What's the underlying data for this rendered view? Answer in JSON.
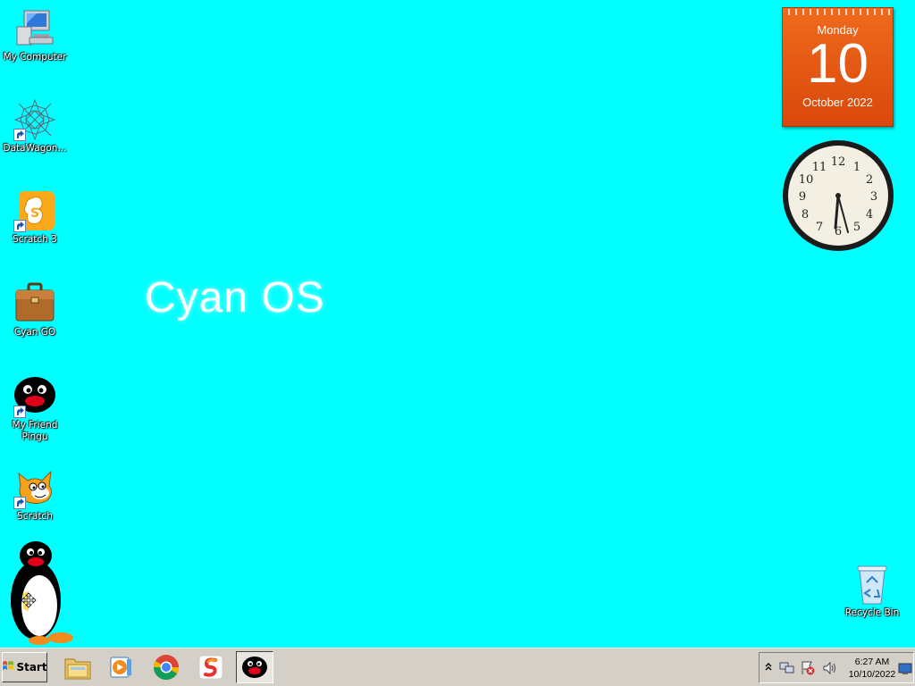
{
  "desktop": {
    "icons": [
      {
        "label": "My Computer",
        "icon": "computer-icon"
      },
      {
        "label": "DataWagon...",
        "icon": "datawagon-icon"
      },
      {
        "label": "Scratch 3",
        "icon": "scratch3-icon"
      },
      {
        "label": "Cyan GO",
        "icon": "briefcase-icon"
      },
      {
        "label": "My Friend Pingu",
        "icon": "pingu-icon"
      },
      {
        "label": "Scratch",
        "icon": "scratch-cat-icon"
      }
    ],
    "brand_text": "Cyan OS",
    "recycle_bin_label": "Recycle Bin",
    "background_color": "#00ffff"
  },
  "calendar": {
    "weekday": "Monday",
    "day": "10",
    "month_year": "October 2022"
  },
  "clock": {
    "hour": 6,
    "minute": 27
  },
  "taskbar": {
    "start_label": "Start",
    "pinned": [
      "file-explorer-icon",
      "media-player-icon",
      "chrome-icon",
      "sketch-app-icon",
      "pingu-app-icon"
    ],
    "tray": {
      "time": "6:27 AM",
      "date": "10/10/2022"
    }
  }
}
